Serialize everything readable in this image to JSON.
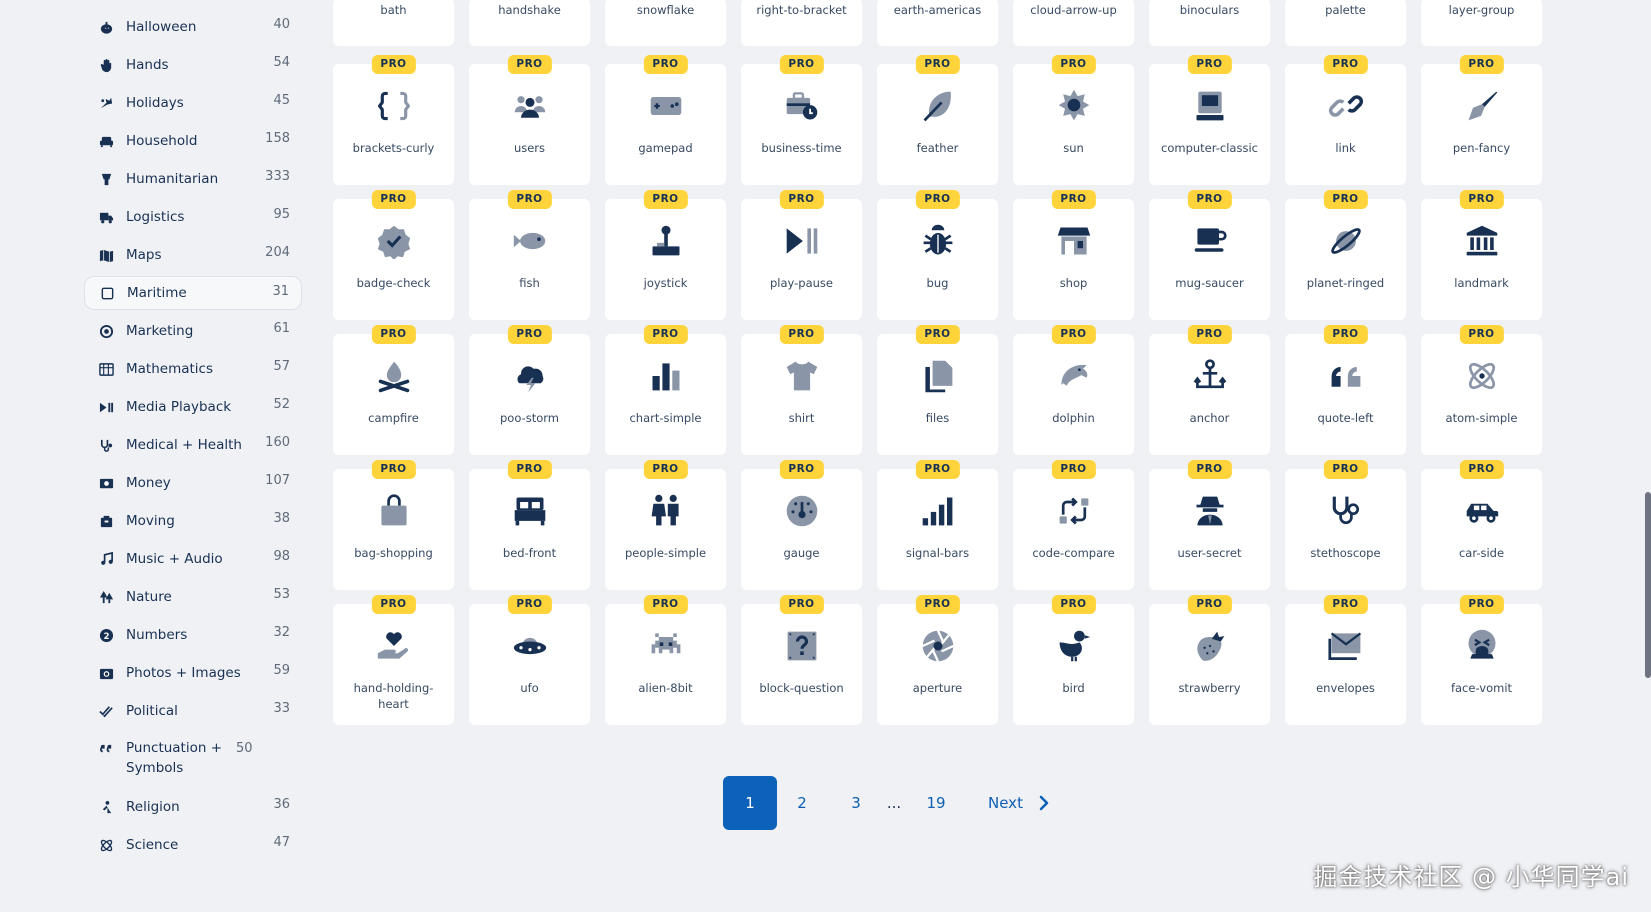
{
  "sidebar": {
    "items": [
      {
        "label": "Halloween",
        "count": "40",
        "icon": "pumpkin-icon"
      },
      {
        "label": "Hands",
        "count": "54",
        "icon": "hand-icon"
      },
      {
        "label": "Holidays",
        "count": "45",
        "icon": "holly-icon"
      },
      {
        "label": "Household",
        "count": "158",
        "icon": "couch-icon"
      },
      {
        "label": "Humanitarian",
        "count": "333",
        "icon": "aid-icon"
      },
      {
        "label": "Logistics",
        "count": "95",
        "icon": "truck-icon"
      },
      {
        "label": "Maps",
        "count": "204",
        "icon": "map-icon"
      },
      {
        "label": "Maritime",
        "count": "31",
        "icon": "checkbox-icon",
        "selected": true
      },
      {
        "label": "Marketing",
        "count": "61",
        "icon": "bullseye-icon"
      },
      {
        "label": "Mathematics",
        "count": "57",
        "icon": "calculator-icon"
      },
      {
        "label": "Media Playback",
        "count": "52",
        "icon": "play-pause-icon"
      },
      {
        "label": "Medical + Health",
        "count": "160",
        "icon": "stethoscope-icon"
      },
      {
        "label": "Money",
        "count": "107",
        "icon": "money-bill-icon"
      },
      {
        "label": "Moving",
        "count": "38",
        "icon": "box-icon"
      },
      {
        "label": "Music + Audio",
        "count": "98",
        "icon": "music-icon"
      },
      {
        "label": "Nature",
        "count": "53",
        "icon": "trees-icon"
      },
      {
        "label": "Numbers",
        "count": "32",
        "icon": "circle-2-icon"
      },
      {
        "label": "Photos + Images",
        "count": "59",
        "icon": "camera-icon"
      },
      {
        "label": "Political",
        "count": "33",
        "icon": "check-double-icon"
      },
      {
        "label": "Punctuation + Symbols",
        "count": "50",
        "icon": "quote-icon"
      },
      {
        "label": "Religion",
        "count": "36",
        "icon": "pray-icon"
      },
      {
        "label": "Science",
        "count": "47",
        "icon": "atom-icon"
      }
    ]
  },
  "top_row": [
    "bath",
    "handshake",
    "snowflake",
    "right-to-bracket",
    "earth-americas",
    "cloud-arrow-up",
    "binoculars",
    "palette",
    "layer-group"
  ],
  "grid": [
    [
      "brackets-curly",
      "users",
      "gamepad",
      "business-time",
      "feather",
      "sun",
      "computer-classic",
      "link",
      "pen-fancy"
    ],
    [
      "badge-check",
      "fish",
      "joystick",
      "play-pause",
      "bug",
      "shop",
      "mug-saucer",
      "planet-ringed",
      "landmark"
    ],
    [
      "campfire",
      "poo-storm",
      "chart-simple",
      "shirt",
      "files",
      "dolphin",
      "anchor",
      "quote-left",
      "atom-simple"
    ],
    [
      "bag-shopping",
      "bed-front",
      "people-simple",
      "gauge",
      "signal-bars",
      "code-compare",
      "user-secret",
      "stethoscope",
      "car-side"
    ],
    [
      "hand-holding-heart",
      "ufo",
      "alien-8bit",
      "block-question",
      "aperture",
      "bird",
      "strawberry",
      "envelopes",
      "face-vomit"
    ]
  ],
  "badge": "PRO",
  "pagination": {
    "pages": [
      "1",
      "2",
      "3",
      "...",
      "19"
    ],
    "next_label": "Next",
    "current": "1"
  },
  "watermark": "掘金技术社区 @ 小华同学ai",
  "colors": {
    "primary": "#183153",
    "accent_blue": "#0b62b8",
    "pro_badge": "#ffd43b",
    "background": "#f0f1f5"
  }
}
